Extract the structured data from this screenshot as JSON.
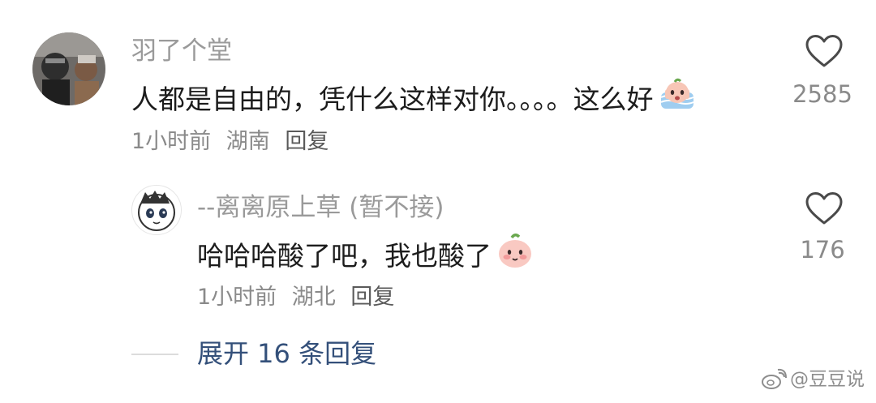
{
  "comment": {
    "username": "羽了个堂",
    "text": "人都是自由的，凭什么这样对你。。。。这么好",
    "emoji": "crying-peach-emoji",
    "meta": {
      "time": "1小时前",
      "location": "湖南",
      "reply": "回复"
    },
    "likes": "2585",
    "like_icon": "heart-outline-icon"
  },
  "reply": {
    "username": "--离离原上草 (暂不接)",
    "text": "哈哈哈酸了吧，我也酸了",
    "emoji": "blushing-peach-emoji",
    "meta": {
      "time": "1小时前",
      "location": "湖北",
      "reply": "回复"
    },
    "likes": "176",
    "like_icon": "heart-outline-icon"
  },
  "expand": {
    "label": "展开 16 条回复"
  },
  "watermark": {
    "text": "@豆豆说",
    "icon": "weibo-icon"
  },
  "colors": {
    "username": "#9a9a9a",
    "content": "#1c1c1c",
    "meta": "#8a8a8a",
    "link": "#34507a"
  }
}
